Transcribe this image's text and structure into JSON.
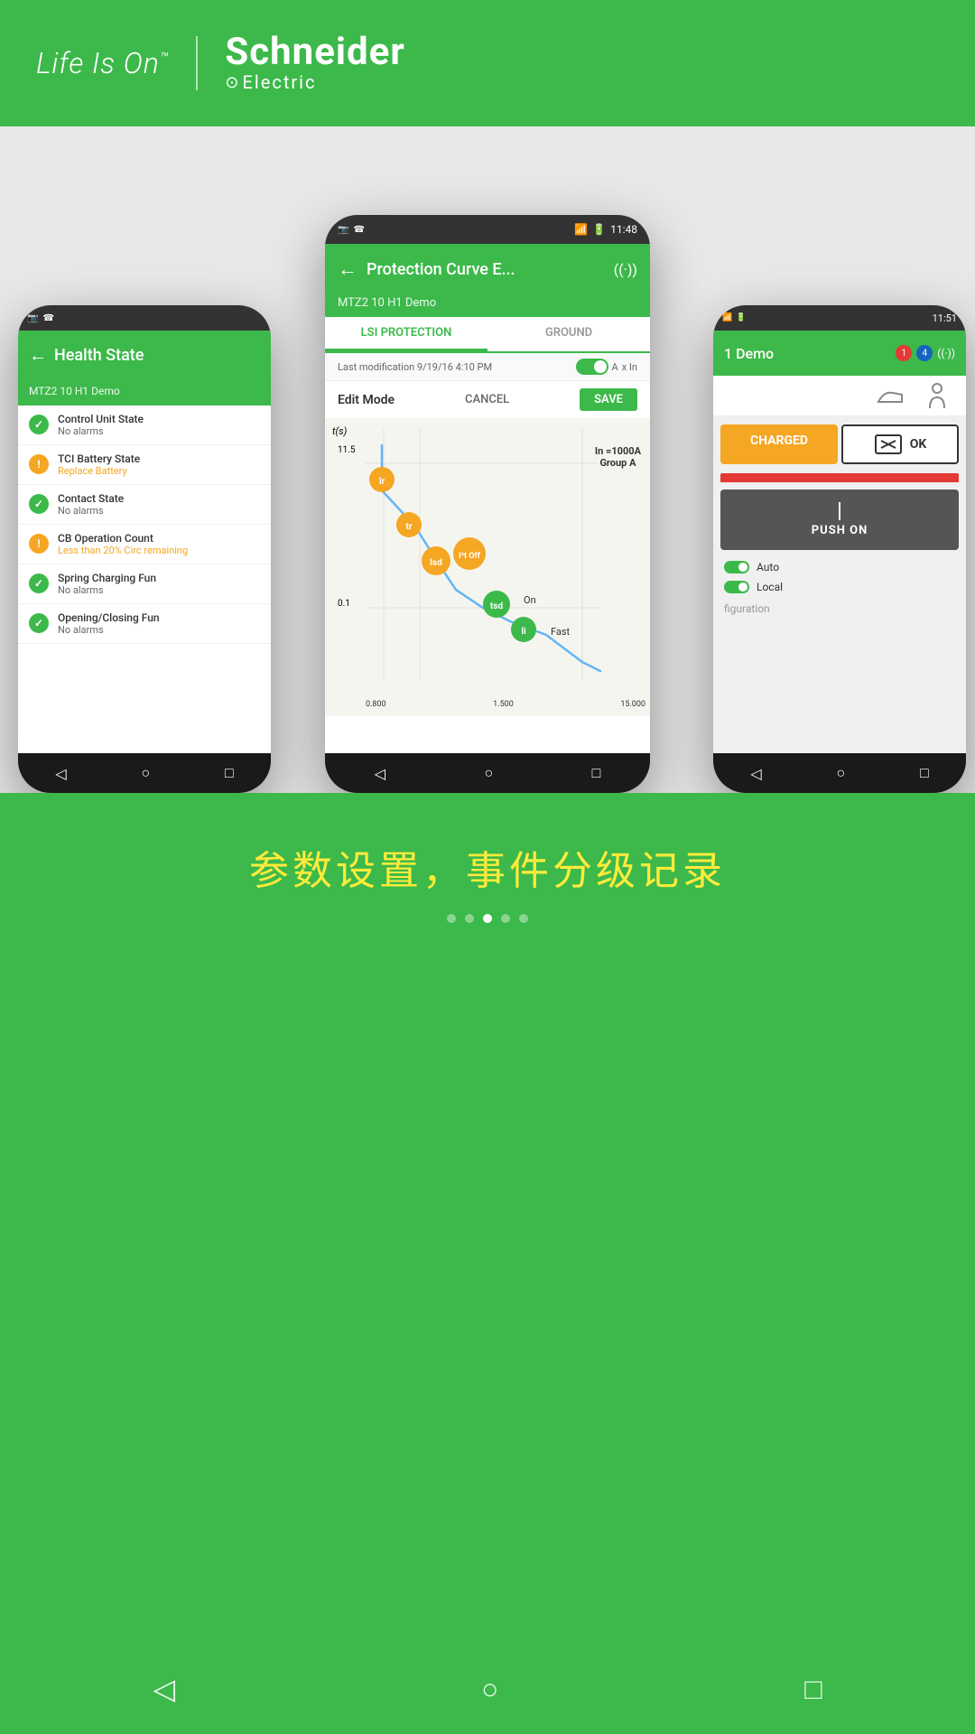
{
  "header": {
    "logo_text": "Life Is On",
    "trademark": "™",
    "brand_name": "Schneider",
    "brand_sub": "Electric"
  },
  "phones": {
    "left": {
      "title": "Health State",
      "device": "MTZ2 10 H1 Demo",
      "items": [
        {
          "label": "Control Unit State",
          "status": "No alarms",
          "type": "ok"
        },
        {
          "label": "TCI Battery State",
          "status": "Replace Battery",
          "type": "warn"
        },
        {
          "label": "Contact State",
          "status": "No alarms",
          "type": "ok"
        },
        {
          "label": "CB Operation Count",
          "status": "Less than 20% Circ remaining",
          "type": "warn"
        },
        {
          "label": "Spring Charging Fun",
          "status": "No alarms",
          "type": "ok"
        },
        {
          "label": "Opening/Closing Fun",
          "status": "No alarms",
          "type": "ok"
        }
      ]
    },
    "center": {
      "title": "Protection Curve E...",
      "device": "MTZ2 10 H1 Demo",
      "time": "11:48",
      "tab_active": "LSI PROTECTION",
      "tab_inactive": "GROUND",
      "modification_label": "Last modification",
      "modification_date": "9/19/16 4:10 PM",
      "toggle_label": "A",
      "toggle_suffix": "x In",
      "edit_mode": "Edit Mode",
      "cancel": "CANCEL",
      "save": "SAVE",
      "chart": {
        "y_label": "t(s)",
        "y_values": [
          "11.5",
          "0.1"
        ],
        "x_values": [
          "0.800",
          "1.500",
          "15.000"
        ],
        "annotation": "In =1000A\nGroup A",
        "nodes": [
          {
            "id": "lr",
            "color": "orange",
            "label": "lr"
          },
          {
            "id": "tr",
            "color": "orange",
            "label": "tr"
          },
          {
            "id": "lsd",
            "color": "orange",
            "label": "lsd"
          },
          {
            "id": "i2t_off",
            "color": "orange",
            "label": "I²t Off"
          },
          {
            "id": "tsd",
            "color": "green",
            "label": "tsd"
          },
          {
            "id": "li",
            "color": "green",
            "label": "li"
          }
        ],
        "on_label": "On",
        "fast_label": "Fast"
      }
    },
    "right": {
      "title": "1 Demo",
      "time": "11:51",
      "badge_red": "1",
      "badge_blue": "4",
      "charged_label": "CHARGED",
      "push_on_label": "PUSH ON",
      "ok_label": "OK",
      "auto_label": "Auto",
      "local_label": "Local",
      "config_label": "figuration"
    }
  },
  "caption": "参数设置，事件分级记录",
  "nav": {
    "back": "◁",
    "home": "○",
    "recent": "□"
  }
}
